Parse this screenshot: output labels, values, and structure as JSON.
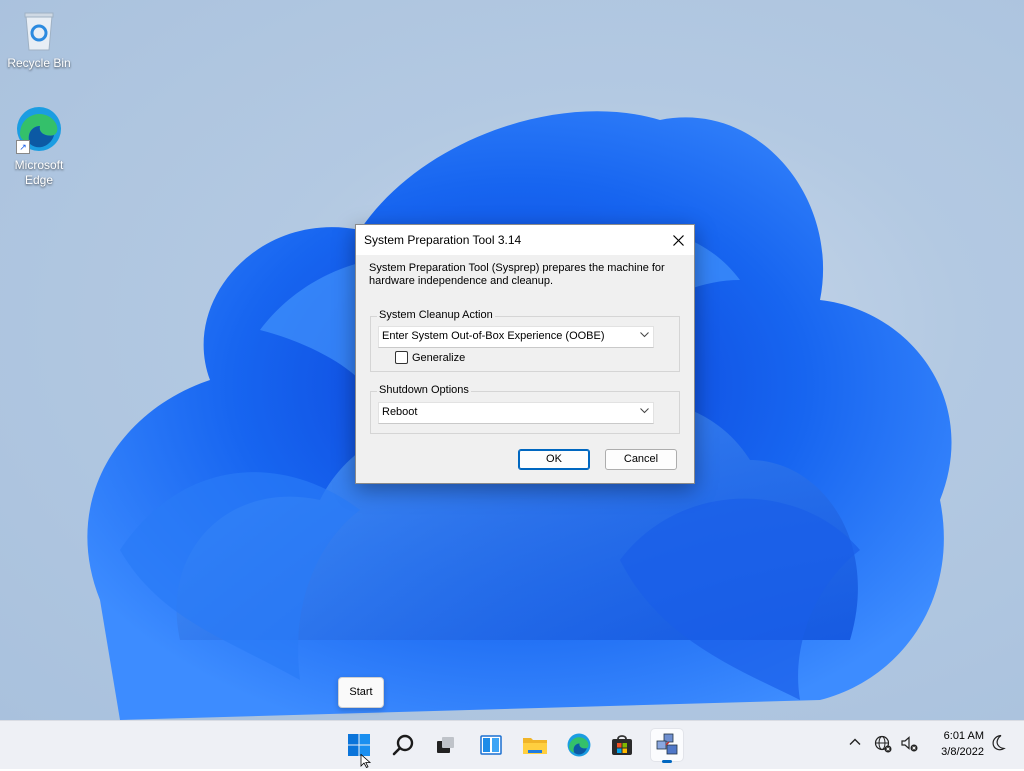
{
  "desktop": {
    "icons": [
      {
        "label": "Recycle Bin"
      },
      {
        "label": "Microsoft Edge"
      }
    ]
  },
  "dialog": {
    "title": "System Preparation Tool 3.14",
    "description": "System Preparation Tool (Sysprep) prepares the machine for hardware independence and cleanup.",
    "cleanup": {
      "legend": "System Cleanup Action",
      "selected": "Enter System Out-of-Box Experience (OOBE)",
      "generalize_label": "Generalize",
      "generalize_checked": false
    },
    "shutdown": {
      "legend": "Shutdown Options",
      "selected": "Reboot"
    },
    "ok_label": "OK",
    "cancel_label": "Cancel"
  },
  "tooltip": {
    "text": "Start"
  },
  "taskbar": {
    "icons": [
      "windows-start-icon",
      "search-icon",
      "task-view-icon",
      "widgets-icon",
      "file-explorer-icon",
      "edge-icon",
      "store-icon",
      "sysprep-icon"
    ],
    "time": "6:01 AM",
    "date": "3/8/2022"
  },
  "colors": {
    "accent": "#0067c0",
    "taskbar": "#eef0f5"
  }
}
